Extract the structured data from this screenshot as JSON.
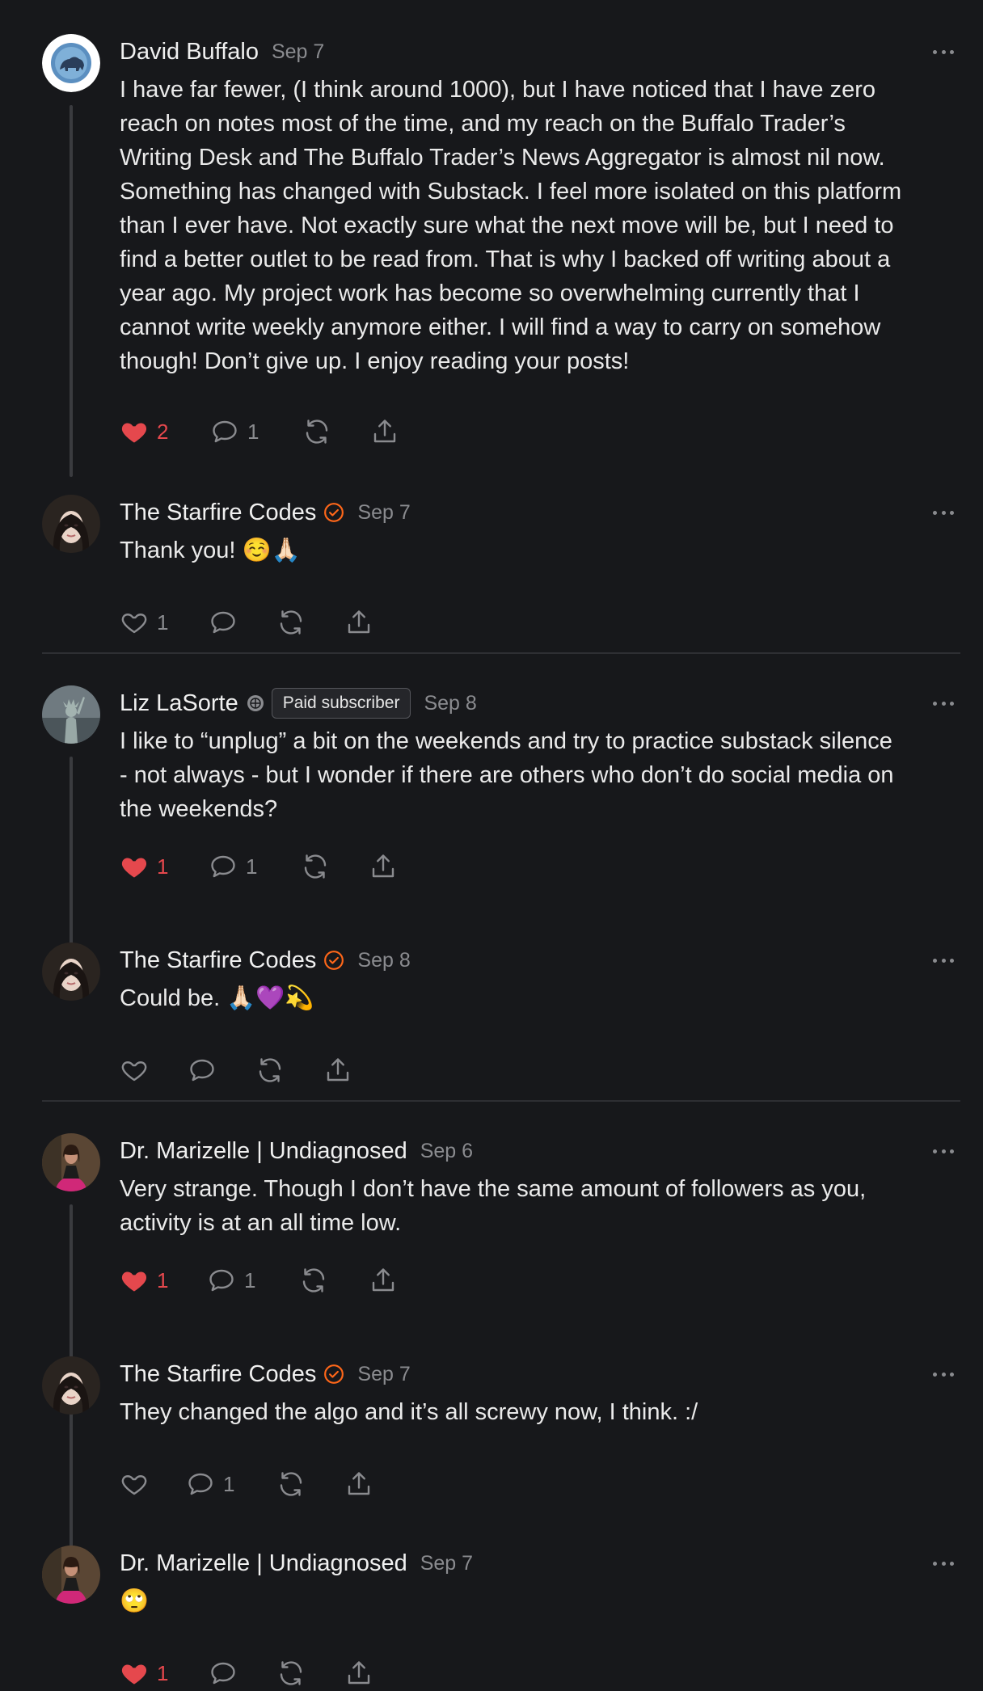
{
  "colors": {
    "background": "#17181b",
    "text": "#ebebeb",
    "muted": "#8a8b8f",
    "like": "#e5484d",
    "verified": "#ff6719"
  },
  "icons": {
    "like": "heart-icon",
    "comment": "comment-icon",
    "restack": "restack-icon",
    "share": "share-icon",
    "more": "more-icon",
    "verified": "verified-check-icon",
    "subscriber": "globe-icon"
  },
  "comments": [
    {
      "author": "David Buffalo",
      "date": "Sep 7",
      "text": "I have far fewer, (I think around 1000), but I have noticed that I have zero\nreach on notes most of the time, and my reach on the Buffalo Trader’s\nWriting Desk and The Buffalo Trader’s News Aggregator is almost nil now.\nSomething has changed with Substack. I feel more isolated on this platform\nthan I ever have. Not exactly sure what the next move will be, but I need to\nfind a better outlet to be read from. That is why I backed off writing about a\nyear ago. My project work has become so overwhelming currently that I\ncannot write weekly anymore either. I will find a way to carry on somehow\nthough! Don’t give up. I enjoy reading your posts!",
      "likes": "2",
      "comments": "1",
      "liked": true
    },
    {
      "author": "The Starfire Codes",
      "date": "Sep 7",
      "text": "Thank you! ☺️🙏🏻",
      "likes": "1",
      "comments": "",
      "liked": false
    },
    {
      "author": "Liz LaSorte",
      "badge": "Paid subscriber",
      "date": "Sep 8",
      "text": "I like to “unplug” a bit on the weekends and try to practice substack silence\n- not always - but I wonder if there are others who don’t do social media on\nthe weekends?",
      "likes": "1",
      "comments": "1",
      "liked": true
    },
    {
      "author": "The Starfire Codes",
      "date": "Sep 8",
      "text": "Could be. 🙏🏻💜💫",
      "likes": "",
      "comments": "",
      "liked": false
    },
    {
      "author": "Dr. Marizelle | Undiagnosed",
      "date": "Sep 6",
      "text": "Very strange. Though I don’t have the same amount of followers as you,\nactivity is at an all time low.",
      "likes": "1",
      "comments": "1",
      "liked": true
    },
    {
      "author": "The Starfire Codes",
      "date": "Sep 7",
      "text": "They changed the algo and it’s all screwy now, I think. :/",
      "likes": "",
      "comments": "1",
      "liked": false
    },
    {
      "author": "Dr. Marizelle | Undiagnosed",
      "date": "Sep 7",
      "text": "🙄",
      "likes": "1",
      "comments": "",
      "liked": true
    }
  ]
}
